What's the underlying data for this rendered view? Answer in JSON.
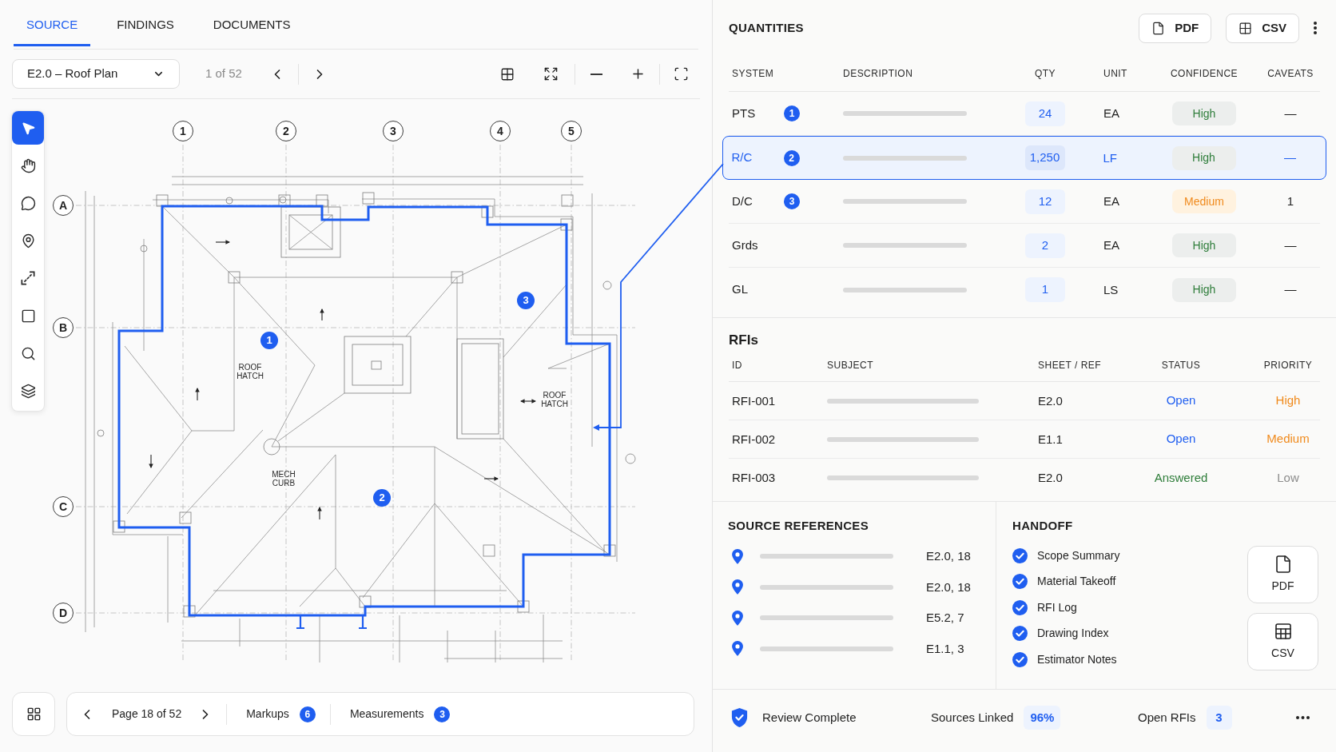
{
  "tabs": [
    {
      "label": "SOURCE",
      "selected": true
    },
    {
      "label": "FINDINGS",
      "selected": false
    },
    {
      "label": "DOCUMENTS",
      "selected": false
    }
  ],
  "sheet_toolbar": {
    "sheet": "E2.0 – Roof Plan",
    "sheet_position": "1 of 52"
  },
  "tools": [
    {
      "kind": "select",
      "selected": true
    },
    {
      "kind": "pan",
      "selected": false
    },
    {
      "kind": "comment",
      "selected": false
    },
    {
      "kind": "pin",
      "selected": false
    },
    {
      "kind": "measure",
      "selected": false
    },
    {
      "kind": "area",
      "selected": false
    },
    {
      "kind": "search",
      "selected": false
    },
    {
      "kind": "layers",
      "selected": false
    }
  ],
  "drawing": {
    "grid_columns": [
      "1",
      "2",
      "3",
      "4",
      "5"
    ],
    "grid_rows": [
      "A",
      "B",
      "C",
      "D"
    ],
    "notes": [
      "ROOF HATCH",
      "ROOF HATCH",
      "MECH CURB"
    ],
    "markers": [
      "1",
      "2",
      "3"
    ]
  },
  "page_nav": {
    "page": "Page 18 of 52",
    "counters": [
      {
        "label": "Markups",
        "count": "6"
      },
      {
        "label": "Measurements",
        "count": "3"
      }
    ]
  },
  "quantities": {
    "title": "QUANTITIES",
    "exports": [
      {
        "kind": "pdf",
        "label": "PDF"
      },
      {
        "kind": "csv",
        "label": "CSV"
      }
    ],
    "columns": [
      "SYSTEM",
      "DESCRIPTION",
      "QTY",
      "UNIT",
      "CONFIDENCE",
      "CAVEATS"
    ],
    "rows": [
      {
        "system": "PTS",
        "marker": "1",
        "qty": "24",
        "unit": "EA",
        "confidence": {
          "text": "High",
          "kind": "high"
        },
        "caveats": "—",
        "selected": false
      },
      {
        "system": "R/C",
        "marker": "2",
        "qty": "1,250",
        "unit": "LF",
        "confidence": {
          "text": "High",
          "kind": "high"
        },
        "caveats": "—",
        "selected": true
      },
      {
        "system": "D/C",
        "marker": "3",
        "qty": "12",
        "unit": "EA",
        "confidence": {
          "text": "Medium",
          "kind": "medium"
        },
        "caveats": "1",
        "selected": false
      },
      {
        "system": "Grds",
        "qty": "2",
        "unit": "EA",
        "confidence": {
          "text": "High",
          "kind": "high"
        },
        "caveats": "—",
        "selected": false
      },
      {
        "system": "GL",
        "qty": "1",
        "unit": "LS",
        "confidence": {
          "text": "High",
          "kind": "high"
        },
        "caveats": "—",
        "selected": false
      }
    ]
  },
  "rfis": {
    "title": "RFIs",
    "columns": [
      "ID",
      "SUBJECT",
      "SHEET / REF",
      "STATUS",
      "PRIORITY"
    ],
    "rows": [
      {
        "id": "RFI-001",
        "sheet_ref": "E2.0",
        "status": {
          "text": "Open",
          "color": "#1f5ef0"
        },
        "priority": {
          "text": "High",
          "color": "#f08a1c"
        }
      },
      {
        "id": "RFI-002",
        "sheet_ref": "E1.1",
        "status": {
          "text": "Open",
          "color": "#1f5ef0"
        },
        "priority": {
          "text": "Medium",
          "color": "#f08a1c"
        }
      },
      {
        "id": "RFI-003",
        "sheet_ref": "E2.0",
        "status": {
          "text": "Answered",
          "color": "#2e7d3a"
        },
        "priority": {
          "text": "Low",
          "color": "#8c8c8c"
        }
      }
    ]
  },
  "source_references": {
    "title": "SOURCE REFERENCES",
    "items": [
      "E2.0, 18",
      "E2.0, 18",
      "E5.2, 7",
      "E1.1, 3"
    ]
  },
  "handoff": {
    "title": "HANDOFF",
    "items": [
      {
        "label": "Scope Summary",
        "checked": true
      },
      {
        "label": "Material Takeoff",
        "checked": true
      },
      {
        "label": "RFI Log",
        "checked": true
      },
      {
        "label": "Drawing Index",
        "checked": true
      },
      {
        "label": "Estimator Notes",
        "checked": true
      }
    ],
    "exports": [
      {
        "kind": "pdf",
        "label": "PDF"
      },
      {
        "kind": "csv",
        "label": "CSV"
      }
    ]
  },
  "status_bar": {
    "review": "Review Complete",
    "stats": [
      {
        "label": "Sources Linked",
        "value": "96%"
      },
      {
        "label": "Open RFIs",
        "value": "3"
      }
    ]
  }
}
